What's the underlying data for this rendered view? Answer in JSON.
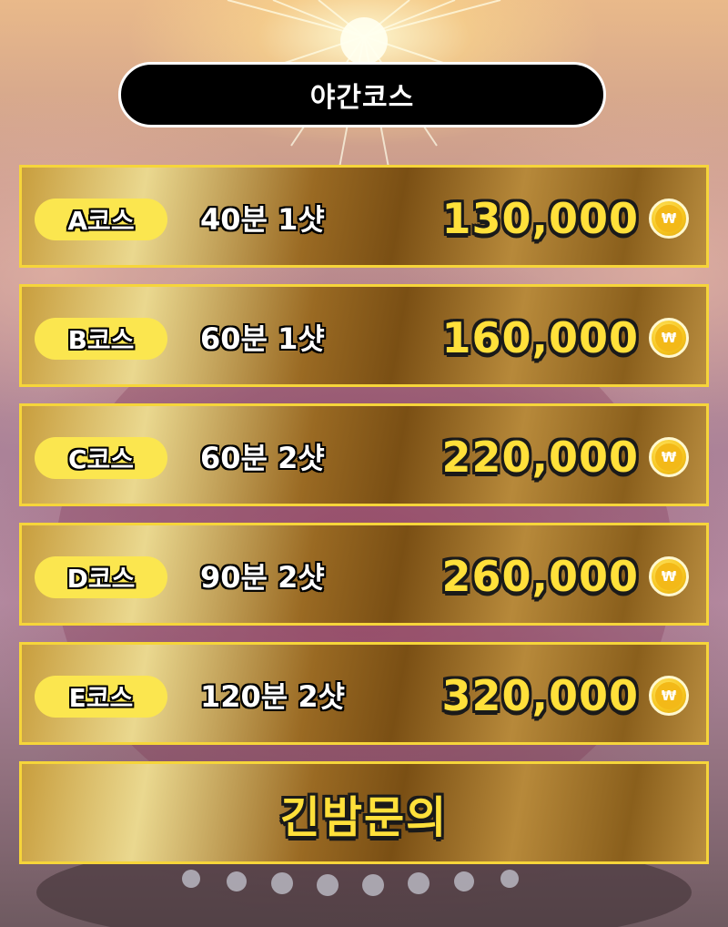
{
  "title": "야간코스",
  "courses": [
    {
      "name": "A코스",
      "duration": "40분 1샷",
      "price": "130,000",
      "currency_icon": "won-coin-icon"
    },
    {
      "name": "B코스",
      "duration": "60분 1샷",
      "price": "160,000",
      "currency_icon": "won-coin-icon"
    },
    {
      "name": "C코스",
      "duration": "60분 2샷",
      "price": "220,000",
      "currency_icon": "won-coin-icon"
    },
    {
      "name": "D코스",
      "duration": "90분 2샷",
      "price": "260,000",
      "currency_icon": "won-coin-icon"
    },
    {
      "name": "E코스",
      "duration": "120분 2샷",
      "price": "320,000",
      "currency_icon": "won-coin-icon"
    }
  ],
  "coin_symbol": "₩",
  "contact_button": "긴밤문의",
  "colors": {
    "pill_yellow": "#fbe64f",
    "price_yellow": "#ffe03a",
    "row_border": "#f6d53a",
    "title_bg": "#000000"
  }
}
